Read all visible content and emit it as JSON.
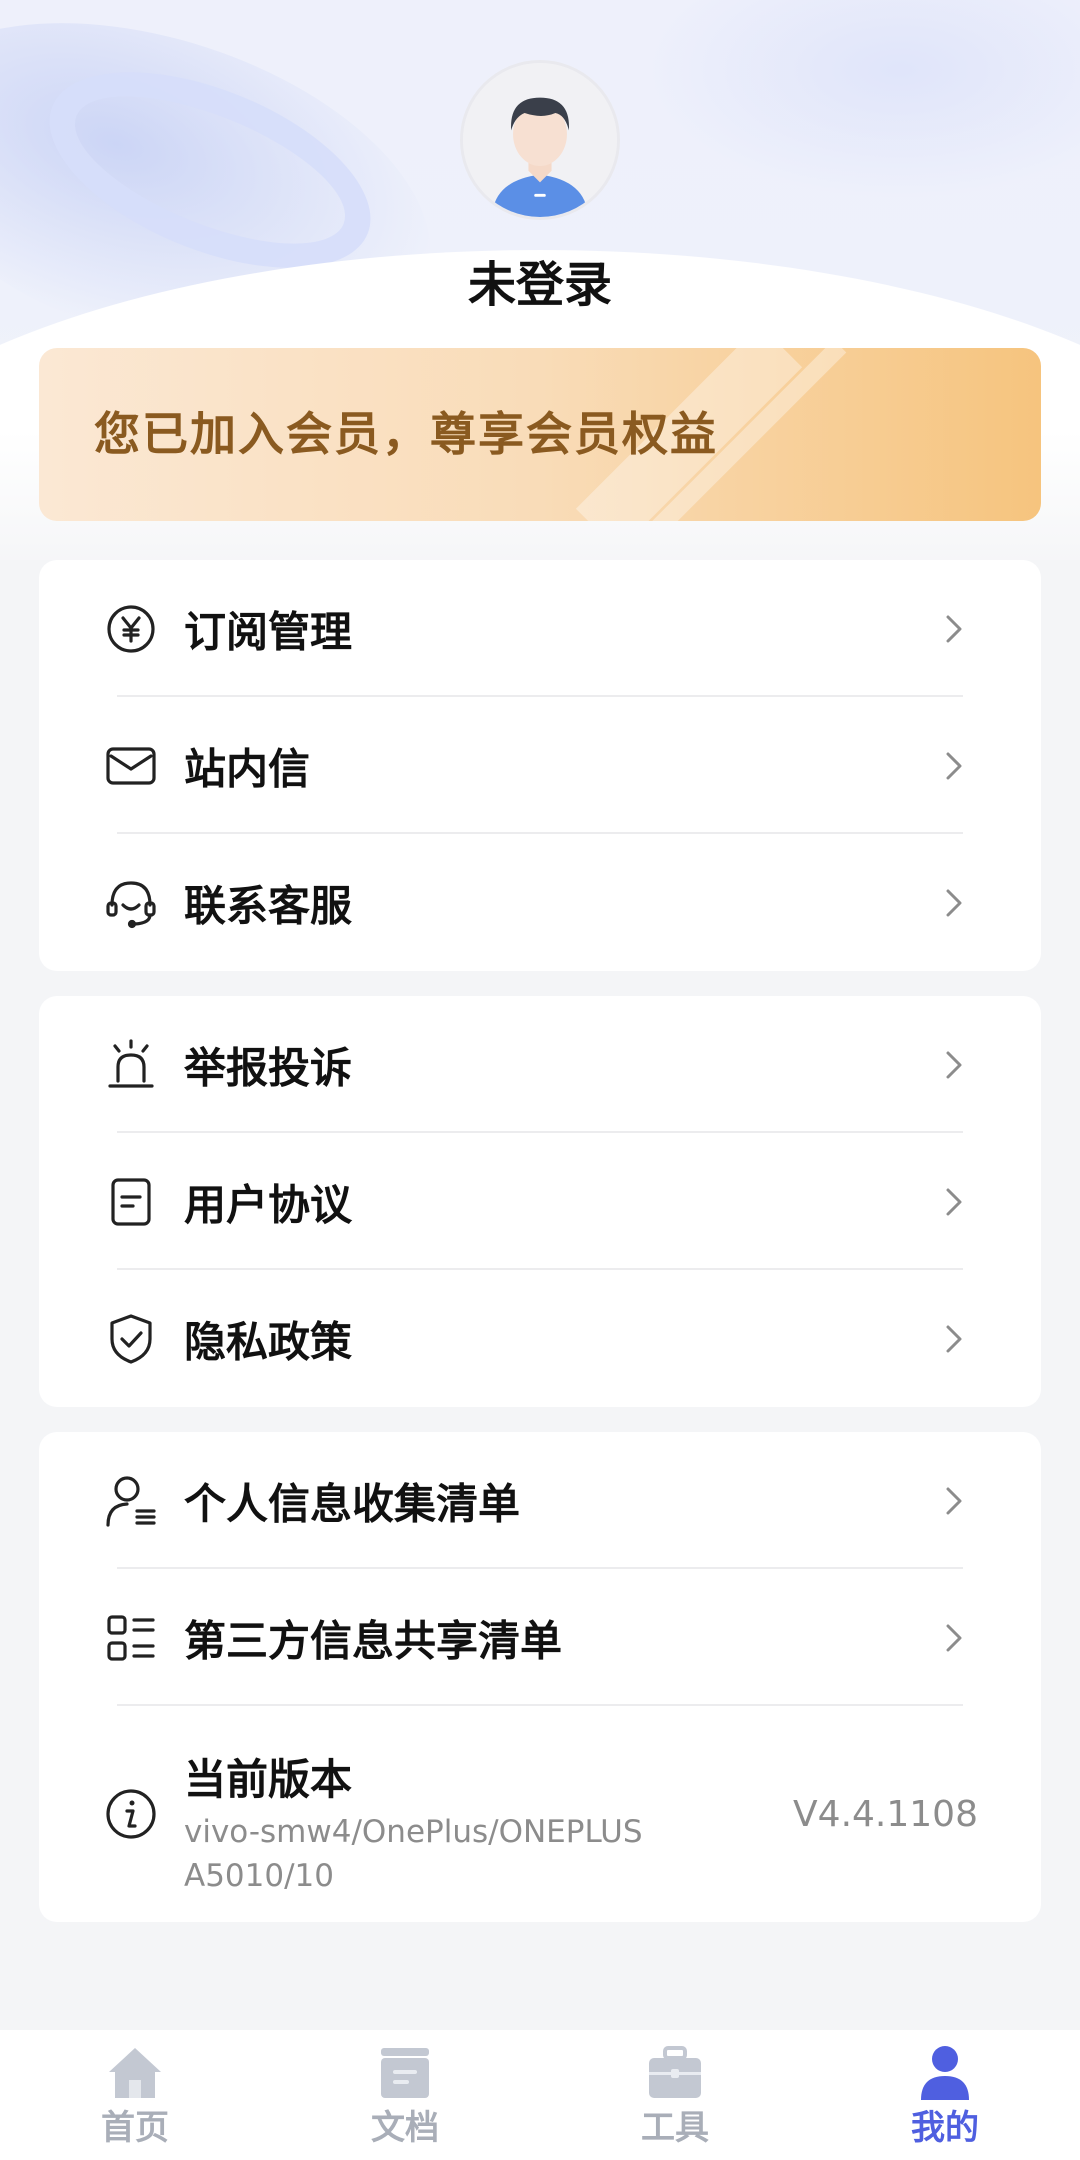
{
  "profile": {
    "username": "未登录"
  },
  "vip": {
    "text": "您已加入会员，尊享会员权益"
  },
  "menu": {
    "group1": [
      {
        "label": "订阅管理",
        "icon": "yen-circle-icon"
      },
      {
        "label": "站内信",
        "icon": "envelope-icon"
      },
      {
        "label": "联系客服",
        "icon": "headset-icon"
      }
    ],
    "group2": [
      {
        "label": "举报投诉",
        "icon": "alarm-icon"
      },
      {
        "label": "用户协议",
        "icon": "document-icon"
      },
      {
        "label": "隐私政策",
        "icon": "shield-check-icon"
      }
    ],
    "group3": [
      {
        "label": "个人信息收集清单",
        "icon": "user-list-icon"
      },
      {
        "label": "第三方信息共享清单",
        "icon": "grid-list-icon"
      }
    ],
    "version": {
      "label": "当前版本",
      "device_line1": "vivo-smw4/OnePlus/ONEPLUS",
      "device_line2": "A5010/10",
      "number": "V4.4.1108",
      "icon": "info-icon"
    }
  },
  "tabbar": {
    "tabs": [
      {
        "label": "首页",
        "icon": "home-icon"
      },
      {
        "label": "文档",
        "icon": "document-box-icon"
      },
      {
        "label": "工具",
        "icon": "toolbox-icon"
      },
      {
        "label": "我的",
        "icon": "user-icon",
        "active": true
      }
    ],
    "active_color": "#4f5fe0",
    "inactive_color": "#a9aeb8"
  }
}
